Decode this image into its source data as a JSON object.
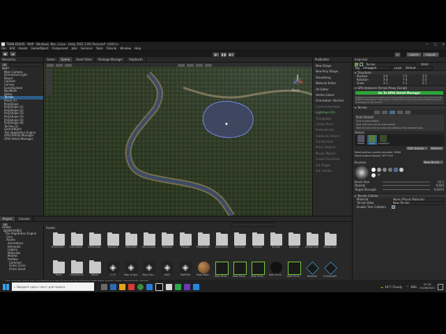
{
  "window": {
    "title": "TDHB-DG005 - MAP - Windows, Mac, Linux - Unity 2021.3.9f1 Personal* <DX11>",
    "controls": [
      "—",
      "□",
      "✕"
    ]
  },
  "menu": [
    "File",
    "Edit",
    "Assets",
    "GameObject",
    "Component",
    "Jobs",
    "Services",
    "Tools",
    "Tutorial",
    "Window",
    "Help"
  ],
  "toolbar": {
    "layers_label": "Layers",
    "layout_label": "Layout"
  },
  "hierarchy": {
    "tab": "Hierarchy",
    "items": [
      "MAP*",
      "Main Camera",
      "Directional Light",
      "Player",
      "Capsule",
      "Canvas",
      "EventSystem",
      "NavMesh",
      "Water",
      "Terrain",
      "Plane (2)",
      "PolyShape",
      "PolyShape (1)",
      "PolyShape (2)",
      "PolyShape (3)",
      "PolyShape (4)",
      "PolyShape (5)",
      "PolyShape (6)",
      "Terrain (1)",
      "GameObject",
      "The Vegetation Engine",
      "GPUI Prefab Manager",
      "GPUI Detail Manager"
    ],
    "selected_index": 9
  },
  "scene": {
    "tabs": [
      "Game",
      "Scene",
      "Asset Store",
      "Package Manager",
      "Polybrush"
    ],
    "active_tab": 1,
    "view_label": "Persp"
  },
  "probuilder": {
    "title": "ProBuilder",
    "items": [
      "New Shape",
      "New Poly Shape",
      "Smoothing",
      "Material Editor",
      "UV Editor",
      "Vertex Colors",
      "Orientation: Normal",
      "Conform Normals",
      "Lightmap UVs",
      "Triangulate",
      "Center Pivot",
      "ProBuilderize",
      "Subdivide Object",
      "Flip Normals",
      "Mirror Objects",
      "Merge Objects",
      "Freeze Transform",
      "Set Trigger",
      "Set Collider"
    ]
  },
  "inspector": {
    "tab": "Inspector",
    "object_name": "Terrain",
    "static_label": "Static",
    "tag_label": "Tag",
    "tag_value": "Untagged",
    "layer_label": "Layer",
    "layer_value": "Default",
    "transform_title": "Transform",
    "transform_rows": [
      {
        "label": "Position",
        "x": "X  0",
        "y": "Y  0",
        "z": "Z  0"
      },
      {
        "label": "Rotation",
        "x": "X  0",
        "y": "Y  0",
        "z": "Z  0"
      },
      {
        "label": "Scale",
        "x": "X  1",
        "y": "Y  1",
        "z": "Z  1"
      }
    ],
    "gpui_component": "GPU Instancer Terrain Proxy (Script)",
    "gpui_banner": "Go To GPUI Detail Manager",
    "gpui_note": "Adding and removing detail and tree prototypes should be done only from the GPU Instancer Managers. Unity terrain component can be used to paint detail and tree prototypes on the terrain.",
    "terrain_title": "Terrain",
    "paint_details_title": "Paint Details",
    "paint_details_help": [
      "Click to paint details.",
      "Hold shift and click to erase details.",
      "Hold Ctrl and click to erase only details of the selected type."
    ],
    "details_label": "Details",
    "detail_thumbs": [
      "Mt0BX",
      "Grass",
      "treeObject"
    ],
    "edit_details_label": "Edit Details...",
    "refresh_label": "Refresh",
    "detail_patches_text": "Detail patches currently allocated: 16384",
    "detail_density_text": "Detail instance density: 16777216",
    "brushes_label": "Brushes",
    "new_brush_label": "New Brush...",
    "brush_size_label": "Brush Size",
    "brush_size_value": "11.1",
    "opacity_label": "Opacity",
    "opacity_value": "0.024",
    "target_strength_label": "Target Strength",
    "target_strength_value": "0.0375",
    "terrain_collider_title": "Terrain Collider",
    "material_label": "Material",
    "material_value": "None (Physic Material)",
    "terrain_data_label": "Terrain Data",
    "terrain_data_value": "New Terrain",
    "enable_tree_label": "Enable Tree Colliders"
  },
  "project": {
    "tabs": [
      "Project",
      "Console"
    ],
    "tree": [
      "Assets",
      "BOXOPHOBIC",
      "The Vegetation Engine",
      "Core",
      "Assets",
      "Animations",
      "Elements",
      "Legacy",
      "Materials",
      "Models",
      "Prefabs",
      "Common",
      "Grass Cross",
      "Grass Quad"
    ],
    "breadcrumb": "Assets",
    "row1": [
      "BOXOPHO...",
      "ExampleA...",
      "GPUInstan...",
      "KriptoFX",
      "Materials",
      "MicroSplat...",
      "Mylatea",
      "Presets",
      "ProBuilder...",
      "Resources",
      "Samples",
      "Scenes",
      "Scripts",
      "Settings",
      "Streaming...",
      "Terrain Co..."
    ],
    "row2": [
      "Trees",
      "TutorialInfo",
      "Water",
      "C_97",
      "Map Origin...",
      "Map Tran...",
      "MAP",
      "MAPSSS",
      "New Mate...",
      "New Terra...",
      "New Terra...",
      "New Terra...",
      "New Terra...",
      "New Terra...",
      "Readme",
      "UniversalR..."
    ],
    "status_message": "The package cache was invalidated and rebuilt because the following immutable asset(s) were unexpectedly altered:"
  },
  "taskbar": {
    "search_placeholder": "Введите здесь текст для поиска",
    "weather": "16°C  Cloudy",
    "language": "ENG",
    "time": "22:16",
    "date": "01/06/2022"
  },
  "colors": {
    "accent_selection": "#2c5d87",
    "gpui_banner_green": "#2fa43a",
    "editor_bg": "#282828",
    "terrain_grass": "#2e3a25"
  }
}
